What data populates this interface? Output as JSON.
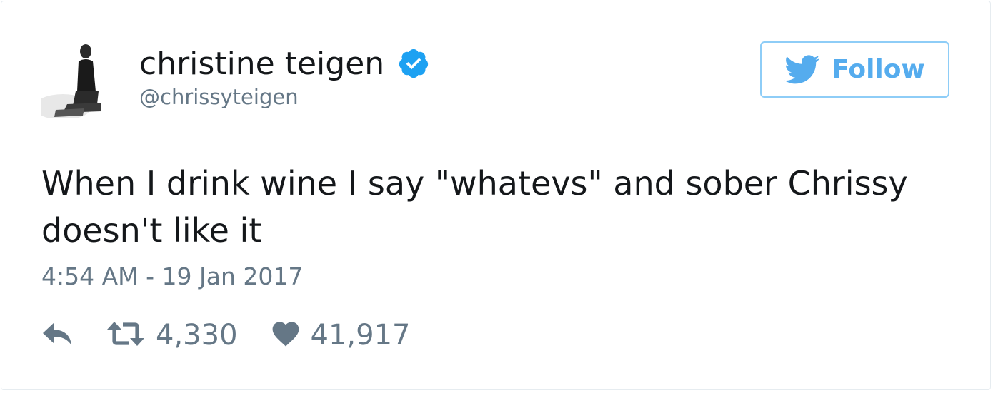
{
  "user": {
    "display_name": "christine teigen",
    "handle": "@chrissyteigen",
    "verified_icon": "verified-badge-icon"
  },
  "follow_button": {
    "label": "Follow",
    "icon": "twitter-bird-icon"
  },
  "tweet": {
    "text": "When I drink wine I say \"whatevs\" and sober Chrissy doesn't like it",
    "timestamp": "4:54 AM - 19 Jan 2017"
  },
  "actions": {
    "reply_icon": "reply-icon",
    "retweet_icon": "retweet-icon",
    "retweet_count": "4,330",
    "like_icon": "heart-icon",
    "like_count": "41,917"
  },
  "colors": {
    "brand": "#55acee",
    "text": "#14171a",
    "secondary": "#657786",
    "verified": "#1da1f2"
  }
}
